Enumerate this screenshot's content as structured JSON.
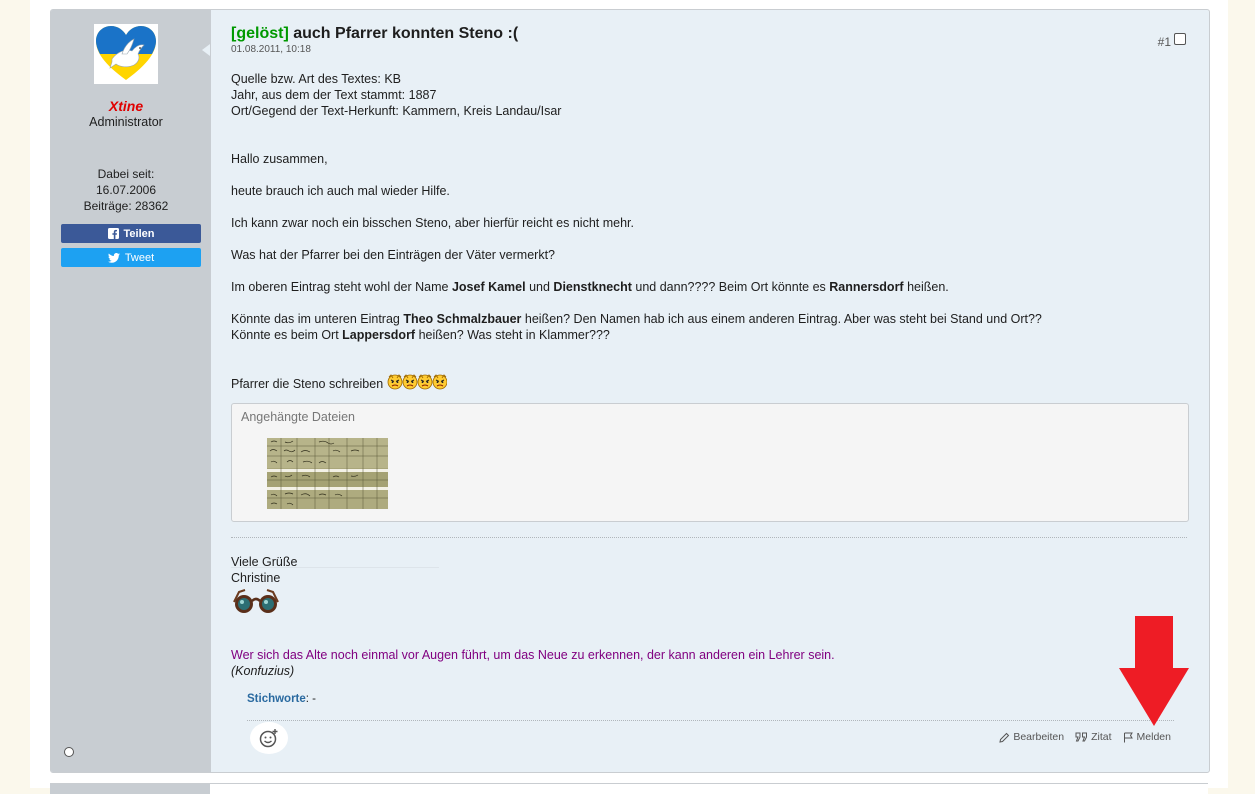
{
  "post": {
    "author": {
      "name": "Xtine",
      "title": "Administrator",
      "joined_label": "Dabei seit:",
      "joined_date": "16.07.2006",
      "posts_label": "Beiträge: 28362"
    },
    "share": {
      "facebook_label": "Teilen",
      "twitter_label": "Tweet"
    },
    "title_prefix": "[gelöst]",
    "title": "auch Pfarrer konnten Steno :(",
    "date": "01.08.2011, 10:18",
    "number": "#1",
    "body": {
      "source_line": "Quelle bzw. Art des Textes: KB",
      "year_line": "Jahr, aus dem der Text stammt: 1887",
      "place_line": "Ort/Gegend der Text-Herkunft: Kammern, Kreis Landau/Isar",
      "greeting": "Hallo zusammen,",
      "p1": "heute brauch ich auch mal wieder Hilfe.",
      "p2": "Ich kann zwar noch ein bisschen Steno, aber hierfür reicht es nicht mehr.",
      "p3": "Was hat der Pfarrer bei den Einträgen der Väter vermerkt?",
      "p4_a": "Im oberen Eintrag steht wohl der Name ",
      "p4_b": "Josef Kamel",
      "p4_c": " und ",
      "p4_d": "Dienstknecht",
      "p4_e": " und dann???? Beim Ort könnte es ",
      "p4_f": "Rannersdorf",
      "p4_g": " heißen.",
      "p5_a": "Könnte das im unteren Eintrag ",
      "p5_b": "Theo Schmalzbauer",
      "p5_c": " heißen? Den Namen hab ich aus einem anderen Eintrag. Aber was steht bei Stand und Ort??",
      "p6_a": "Könnte es beim Ort ",
      "p6_b": "Lappersdorf",
      "p6_c": " heißen? Was steht in Klammer???",
      "p7": "Pfarrer die Steno schreiben "
    },
    "attachments": {
      "title": "Angehängte Dateien"
    },
    "signature": {
      "line1": "Viele Grüße",
      "line2": "Christine",
      "quote": "Wer sich das Alte noch einmal vor Augen führt, um das Neue zu erkennen, der kann anderen ein Lehrer sein.",
      "quote_author": "(Konfuzius)"
    },
    "tags": {
      "label": "Stichworte",
      "value": ": -"
    },
    "actions": {
      "edit": "Bearbeiten",
      "quote": "Zitat",
      "report": "Melden"
    }
  },
  "colors": {
    "prefix_green": "#009900",
    "username_red": "#e00000",
    "quote_purple": "#800080",
    "facebook_blue": "#3b5998",
    "twitter_blue": "#1da1f2",
    "annotation_arrow_red": "#ee1c25"
  },
  "icons": [
    "dove-heart-avatar",
    "facebook-icon",
    "twitter-icon",
    "angry-smiley-icon",
    "glasses-icon",
    "add-reaction-icon",
    "pencil-icon",
    "quote-icon",
    "flag-icon",
    "online-status-icon",
    "red-arrow-annotation"
  ]
}
